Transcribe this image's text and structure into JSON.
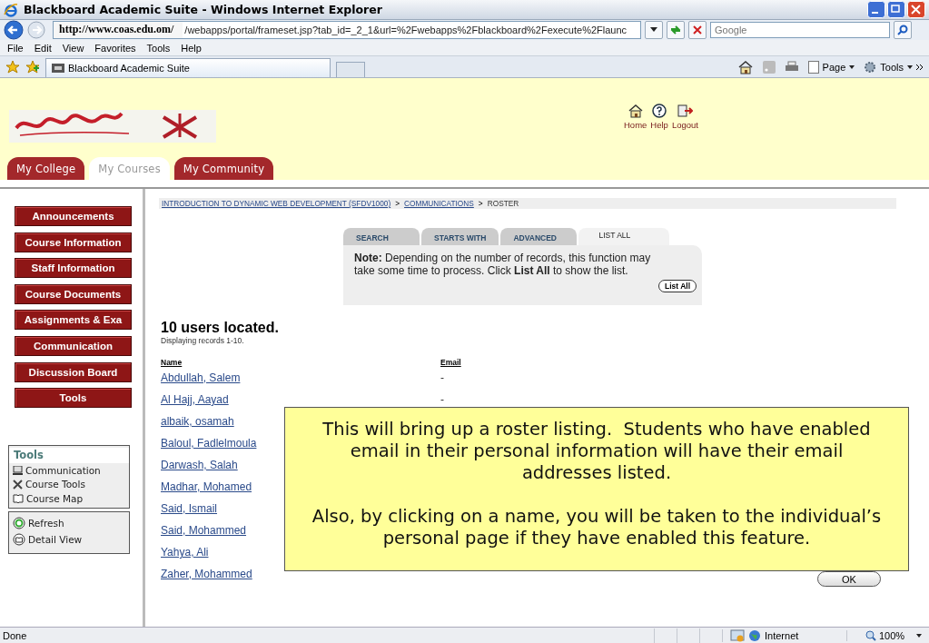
{
  "window": {
    "title": "Blackboard Academic Suite - Windows Internet Explorer"
  },
  "address_bar": {
    "host": "http://www.coas.edu.om/",
    "path": "/webapps/portal/frameset.jsp?tab_id=_2_1&url=%2Fwebapps%2Fblackboard%2Fexecute%2Flaunc"
  },
  "search": {
    "placeholder": "Google"
  },
  "menu": [
    "File",
    "Edit",
    "View",
    "Favorites",
    "Tools",
    "Help"
  ],
  "browser_tabs": [
    {
      "label": "Blackboard Academic Suite",
      "selected": true
    }
  ],
  "command_bar": [
    "Page",
    "Tools"
  ],
  "portal": {
    "nav": [
      "Home",
      "Help",
      "Logout"
    ],
    "tabs": [
      {
        "label": "My College",
        "selected": false
      },
      {
        "label": "My Courses",
        "selected": true
      },
      {
        "label": "My Community",
        "selected": false
      }
    ]
  },
  "course_menu": [
    "Announcements",
    "Course Information",
    "Staff Information",
    "Course Documents",
    "Assignments & Exa",
    "Communication",
    "Discussion Board",
    "Tools"
  ],
  "tools_panel": {
    "title": "Tools",
    "items": [
      "Communication",
      "Course Tools",
      "Course Map"
    ]
  },
  "view_panel": [
    "Refresh",
    "Detail View"
  ],
  "breadcrumb": {
    "separator": ">",
    "items": [
      {
        "text": "INTRODUCTION TO DYNAMIC WEB DEVELOPMENT (SFDV1000)",
        "link": true
      },
      {
        "text": "COMMUNICATIONS",
        "link": true
      },
      {
        "text": "ROSTER",
        "link": false
      }
    ]
  },
  "search_tabs": [
    {
      "label": "SEARCH",
      "selected": false
    },
    {
      "label": "STARTS WITH",
      "selected": false
    },
    {
      "label": "ADVANCED",
      "selected": false
    },
    {
      "label": "LIST ALL",
      "selected": true
    }
  ],
  "note": "**Note:** Depending on the number of records, this function may take some time to process. Click **List All** to show the list.",
  "list_all_button": "List All",
  "result": {
    "heading": "10 users located.",
    "subheading": "Displaying records 1-10."
  },
  "table": {
    "columns": [
      "Name",
      "Email"
    ],
    "rows": [
      {
        "name": "Abdullah, Salem",
        "email": "-"
      },
      {
        "name": "Al Hajj, Aayad",
        "email": "-"
      },
      {
        "name": "albaik, osamah"
      },
      {
        "name": "Baloul, Fadlelmoula"
      },
      {
        "name": "Darwash, Salah"
      },
      {
        "name": "Madhar, Mohamed"
      },
      {
        "name": "Said, Ismail"
      },
      {
        "name": "Said, Mohammed"
      },
      {
        "name": "Yahya, Ali"
      },
      {
        "name": "Zaher, Mohammed"
      }
    ]
  },
  "callout": {
    "paragraphs": [
      "This will bring up a roster listing.  Students who have enabled email in their personal information will have their email addresses listed.",
      "Also, by clicking on a name, you will be taken to the individual’s personal page if they have enabled this feature."
    ]
  },
  "ok_button": "OK",
  "status_bar": {
    "text": "Done",
    "zone": "Internet",
    "zoom": "100%"
  }
}
